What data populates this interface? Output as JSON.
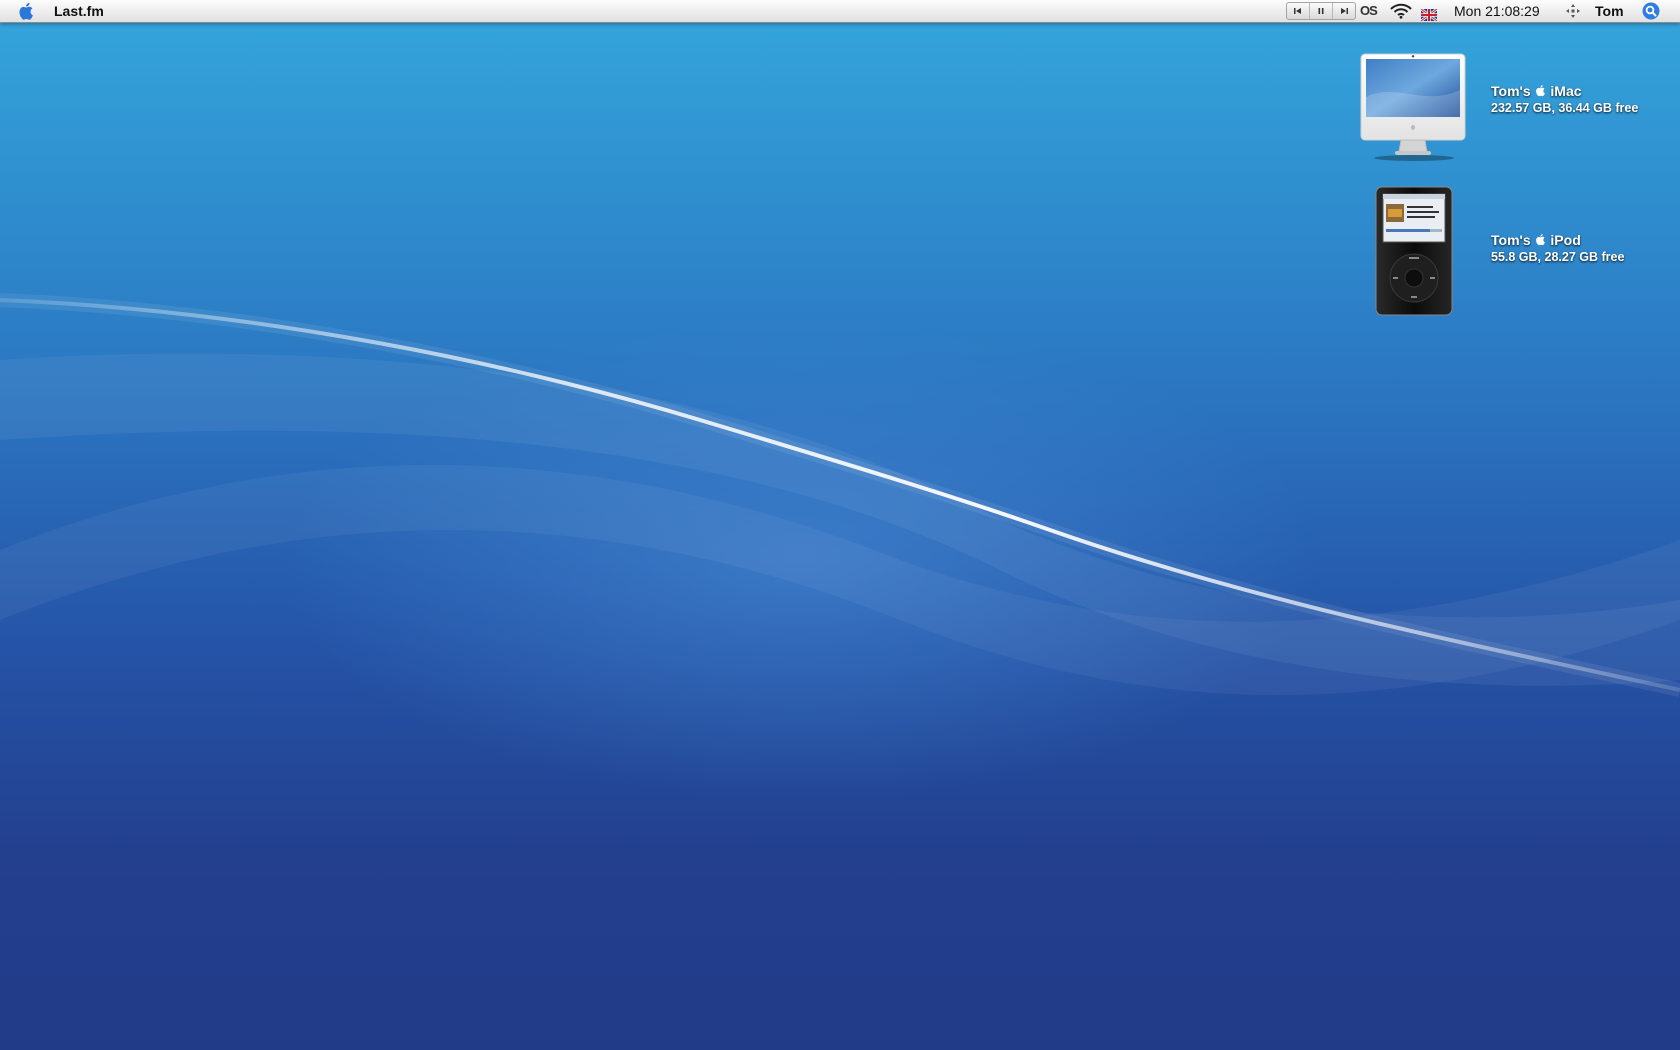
{
  "menubar": {
    "app_name": "Last.fm",
    "apple_icon": "apple-logo-icon",
    "status_items": {
      "media_controls": [
        "previous-track-icon",
        "pause-icon",
        "next-track-icon"
      ],
      "lastfm_label": "OS",
      "wifi": "wifi-icon",
      "input_source": "uk-flag-icon",
      "clock": "Mon 21:08:29",
      "spaces": "spaces-icon",
      "user": "Tom",
      "spotlight": "spotlight-search-icon"
    }
  },
  "desktop": {
    "volumes": [
      {
        "name_prefix": "Tom's",
        "name_suffix": "iMac",
        "info": "232.57 GB, 36.44 GB free",
        "icon": "imac-icon"
      },
      {
        "name_prefix": "Tom's",
        "name_suffix": "iPod",
        "info": "55.8 GB, 28.27 GB free",
        "icon": "ipod-icon"
      }
    ]
  },
  "colors": {
    "wallpaper_top": "#35a6dc",
    "wallpaper_bottom": "#223b88",
    "spotlight": "#2f7de1"
  }
}
